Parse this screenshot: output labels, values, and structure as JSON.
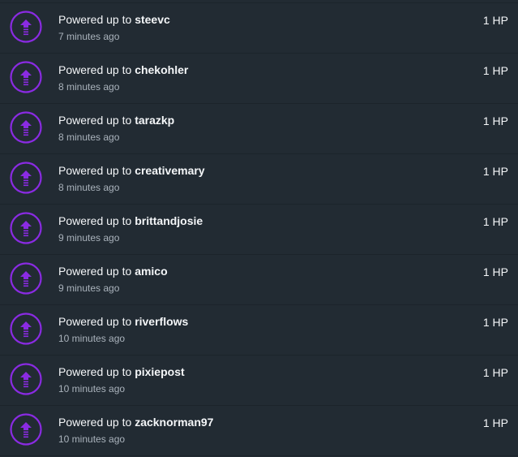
{
  "colors": {
    "background": "#222b33",
    "accent": "#8a2be2",
    "text": "#f4f6f8",
    "muted": "#aab3bc"
  },
  "icon": "power-up-arrow-icon",
  "activities": [
    {
      "prefix": "Powered up to",
      "user": "steevc",
      "time": "7 minutes ago",
      "amount": "1 HP"
    },
    {
      "prefix": "Powered up to",
      "user": "chekohler",
      "time": "8 minutes ago",
      "amount": "1 HP"
    },
    {
      "prefix": "Powered up to",
      "user": "tarazkp",
      "time": "8 minutes ago",
      "amount": "1 HP"
    },
    {
      "prefix": "Powered up to",
      "user": "creativemary",
      "time": "8 minutes ago",
      "amount": "1 HP"
    },
    {
      "prefix": "Powered up to",
      "user": "brittandjosie",
      "time": "9 minutes ago",
      "amount": "1 HP"
    },
    {
      "prefix": "Powered up to",
      "user": "amico",
      "time": "9 minutes ago",
      "amount": "1 HP"
    },
    {
      "prefix": "Powered up to",
      "user": "riverflows",
      "time": "10 minutes ago",
      "amount": "1 HP"
    },
    {
      "prefix": "Powered up to",
      "user": "pixiepost",
      "time": "10 minutes ago",
      "amount": "1 HP"
    },
    {
      "prefix": "Powered up to",
      "user": "zacknorman97",
      "time": "10 minutes ago",
      "amount": "1 HP"
    }
  ]
}
